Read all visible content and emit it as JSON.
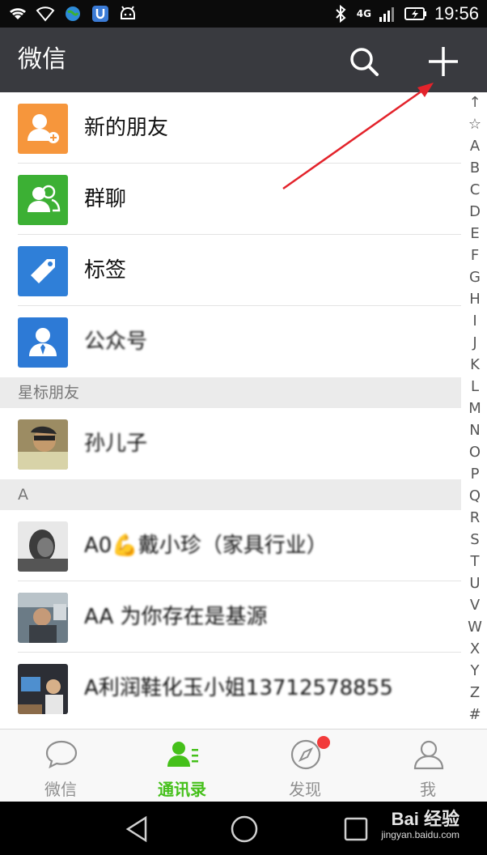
{
  "status_bar": {
    "time": "19:56",
    "network": "4G"
  },
  "app_bar": {
    "title": "微信"
  },
  "rows": [
    {
      "label": "新的朋友"
    },
    {
      "label": "群聊"
    },
    {
      "label": "标签"
    },
    {
      "label": "公众号"
    }
  ],
  "sections": [
    {
      "label": "星标朋友"
    },
    {
      "label": "A"
    }
  ],
  "contacts": [
    {
      "name": "孙儿子"
    },
    {
      "name": "A0💪戴小珍（家具行业）"
    },
    {
      "name": "AA 为你存在是基源"
    },
    {
      "name": "A利润鞋化玉小姐13712578855"
    }
  ],
  "index_letters": [
    "↑",
    "☆",
    "A",
    "B",
    "C",
    "D",
    "E",
    "F",
    "G",
    "H",
    "I",
    "J",
    "K",
    "L",
    "M",
    "N",
    "O",
    "P",
    "Q",
    "R",
    "S",
    "T",
    "U",
    "V",
    "W",
    "X",
    "Y",
    "Z",
    "#"
  ],
  "tabs": [
    {
      "label": "微信"
    },
    {
      "label": "通讯录"
    },
    {
      "label": "发现"
    },
    {
      "label": "我"
    }
  ],
  "watermark": {
    "brand": "Bai 经验",
    "url": "jingyan.baidu.com"
  },
  "colors": {
    "accent": "#45c01a",
    "appbar": "#393a3f",
    "badge": "#f23b3b"
  }
}
